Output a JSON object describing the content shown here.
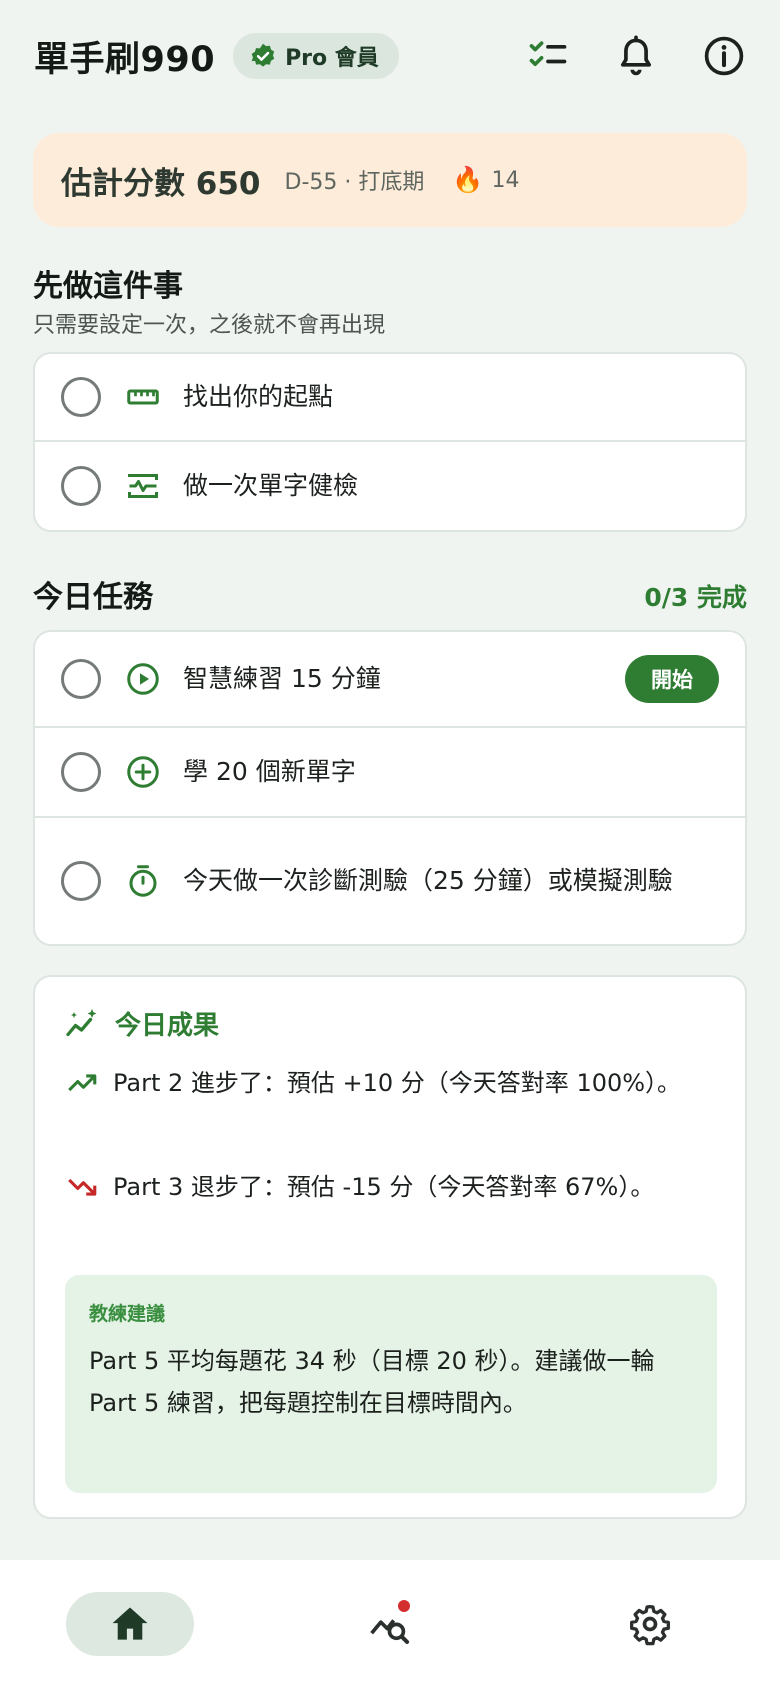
{
  "header": {
    "title": "單手刷990",
    "badge_label": "Pro 會員",
    "badge_icon": "verified-icon",
    "icons": [
      "checklist-icon",
      "bell-icon",
      "info-icon"
    ]
  },
  "score": {
    "label": "估計分數 650",
    "meta": "D-55 · 打底期",
    "streak_emoji": "🔥",
    "streak": "14"
  },
  "setup": {
    "title": "先做這件事",
    "subtitle": "只需要設定一次，之後就不會再出現",
    "items": [
      {
        "label": "找出你的起點",
        "icon": "ruler-icon"
      },
      {
        "label": "做一次單字健檢",
        "icon": "vital-check-icon"
      }
    ]
  },
  "today": {
    "title": "今日任務",
    "progress": "0/3 完成",
    "tasks": [
      {
        "label": "智慧練習 15 分鐘",
        "icon": "play-circle-icon",
        "button": "開始"
      },
      {
        "label": "學 20 個新單字",
        "icon": "add-circle-icon"
      },
      {
        "label": "今天做一次診斷測驗（25 分鐘）或模擬測驗",
        "icon": "timer-icon"
      }
    ]
  },
  "results": {
    "title": "今日成果",
    "items": [
      {
        "text": "Part 2 進步了：預估 +10 分（今天答對率 100%）。",
        "trend": "up"
      },
      {
        "text": "Part 3 退步了：預估 -15 分（今天答對率 67%）。",
        "trend": "down"
      }
    ],
    "coach_title": "教練建議",
    "coach_text": "Part 5 平均每題花 34 秒（目標 20 秒）。建議做一輪 Part 5 練習，把每題控制在目標時間內。"
  },
  "nav": {
    "items": [
      "home-icon",
      "analytics-search-icon",
      "settings-icon"
    ],
    "active": "home-icon"
  },
  "colors": {
    "accent": "#2e7d32",
    "background": "#eff4f1",
    "score_card": "#fdecd9",
    "trend_up": "#2e7d32",
    "trend_down": "#c62828"
  }
}
